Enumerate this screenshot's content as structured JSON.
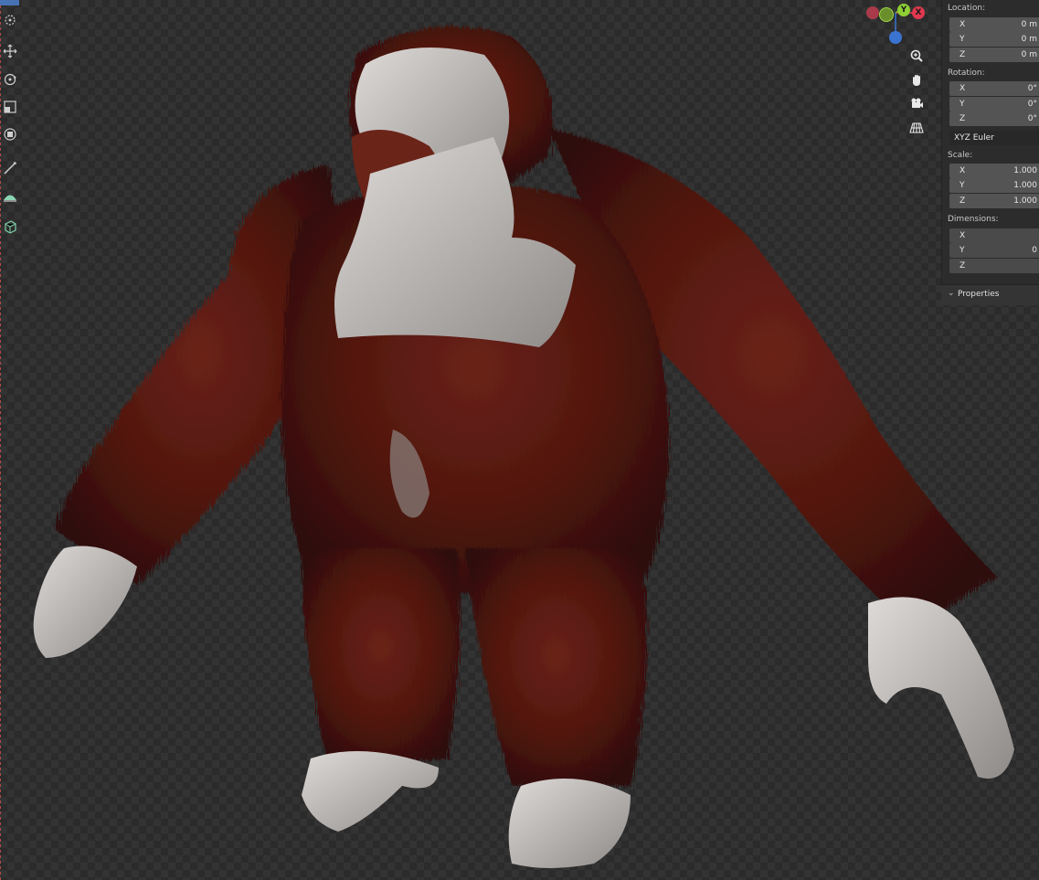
{
  "viewport": {
    "gizmo": {
      "x_label": "X",
      "y_label": "Y",
      "x_color": "#e0384f",
      "y_color": "#7fbb2a",
      "z_color": "#3b73d1"
    }
  },
  "toolbar": {
    "tools": [
      "cursor-tool",
      "move-tool",
      "rotate-tool",
      "scale-tool",
      "transform-tool",
      "annotate-tool",
      "measure-tool",
      "add-cube-tool"
    ],
    "active_color": "#4772b3"
  },
  "nav_icons": [
    "zoom-icon",
    "pan-hand-icon",
    "camera-icon",
    "perspective-grid-icon"
  ],
  "panel": {
    "location": {
      "label": "Location:",
      "rows": [
        {
          "axis": "X",
          "value": "0 m"
        },
        {
          "axis": "Y",
          "value": "0 m"
        },
        {
          "axis": "Z",
          "value": "0 m"
        }
      ]
    },
    "rotation": {
      "label": "Rotation:",
      "rows": [
        {
          "axis": "X",
          "value": "0°"
        },
        {
          "axis": "Y",
          "value": "0°"
        },
        {
          "axis": "Z",
          "value": "0°"
        }
      ]
    },
    "rotation_mode": "XYZ Euler",
    "scale": {
      "label": "Scale:",
      "rows": [
        {
          "axis": "X",
          "value": "1.000"
        },
        {
          "axis": "Y",
          "value": "1.000"
        },
        {
          "axis": "Z",
          "value": "1.000"
        }
      ]
    },
    "dimensions": {
      "label": "Dimensions:",
      "rows": [
        {
          "axis": "X",
          "value": ""
        },
        {
          "axis": "Y",
          "value": "0"
        },
        {
          "axis": "Z",
          "value": ""
        }
      ]
    },
    "properties_label": "Properties"
  },
  "colors": {
    "fur": "#5a1a12",
    "skin": "#c9c4c2",
    "checker_dark": "#2b2b2b",
    "checker_light": "#333333"
  }
}
